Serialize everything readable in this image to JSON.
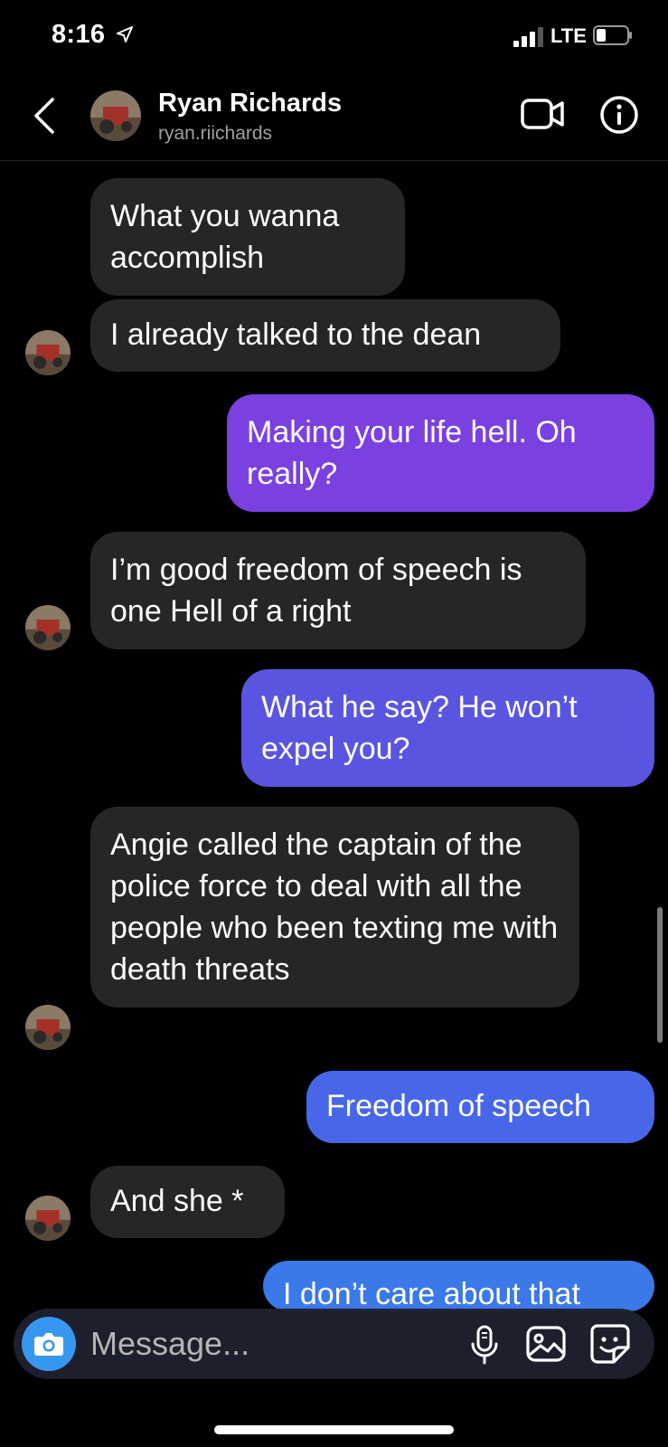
{
  "status": {
    "time": "8:16",
    "network": "LTE"
  },
  "header": {
    "name": "Ryan Richards",
    "handle": "ryan.riichards"
  },
  "messages": [
    {
      "text": "What you wanna accomplish",
      "from": "them"
    },
    {
      "text": "I already talked to the dean",
      "from": "them"
    },
    {
      "text": "Making your life hell. Oh really?",
      "from": "me"
    },
    {
      "text": "I’m good freedom of speech is one Hell of a right",
      "from": "them"
    },
    {
      "text": "What he say? He won’t expel you?",
      "from": "me"
    },
    {
      "text": "Angie called the captain of the police force to deal with all the people who been texting me with death threats",
      "from": "them"
    },
    {
      "text": "Freedom of speech",
      "from": "me"
    },
    {
      "text": "And she *",
      "from": "them"
    },
    {
      "text": "I don’t care about that",
      "from": "me"
    }
  ],
  "composer": {
    "placeholder": "Message..."
  },
  "icons": {
    "back": "chevron-left-icon",
    "video": "video-call-icon",
    "info": "info-icon",
    "camera": "camera-icon",
    "mic": "microphone-icon",
    "gallery": "gallery-icon",
    "sticker": "sticker-icon"
  },
  "colors": {
    "received_bubble": "#262626",
    "sent_gradient": [
      "#7a40e0",
      "#5a55e0",
      "#4767e8",
      "#3b78e8"
    ],
    "camera_button": "#3797f0"
  }
}
